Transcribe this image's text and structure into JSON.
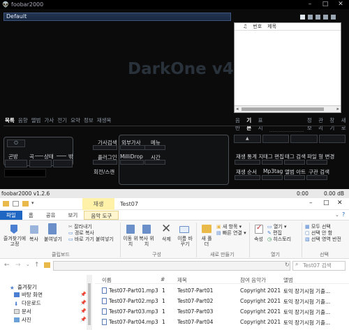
{
  "foobar": {
    "title": "foobar2000",
    "playlist_tab": "Default",
    "logo_text": "DarkOne v4.0",
    "playlist_columns": [
      "♫",
      "번호",
      "제목"
    ],
    "left_tabs": [
      "목록",
      "음향",
      "앨범",
      "가사",
      "전기",
      "요약",
      "정보",
      "재생목"
    ],
    "right_tabs": [
      "음반",
      "기본",
      "표시",
      "가사",
      "",
      "",
      "",
      "",
      "",
      "정보",
      "관리",
      "창기",
      "새로"
    ],
    "right_tab_selected": 1,
    "left_buttons": {
      "power": "⏻",
      "mode": "곤방",
      "track": "곡",
      "state": "상태",
      "num": "밖"
    },
    "center_left_buttons": [
      "가사검색",
      "플러그인",
      "회전/스캔"
    ],
    "center_btns": {
      "lyrics_ext": "외부가사",
      "milli": "MilliDrop",
      "menu": "메뉴",
      "time": "시간"
    },
    "right_buttons": [
      "재생 통계 지",
      "태그 편집",
      "태그 검색",
      "파일 형 변경",
      "재생 순서",
      "Mp3tag",
      "앨범 아트",
      "구관 검색"
    ],
    "status_left": "foobar2000 v1.2.6",
    "status_time_left": "0:00",
    "status_time_right": "0.00 dB"
  },
  "explorer": {
    "context_tab": "재생",
    "folder_name": "Test07",
    "ribbon_tabs": [
      "파일",
      "홈",
      "공유",
      "보기",
      "음악 도구"
    ],
    "ribbon": {
      "pin": "즐겨찾기에 고정",
      "copy": "복사",
      "paste": "붙여넣기",
      "cut": "잘라내기",
      "copy_path": "경로 복사",
      "paste_shortcut": "바로 가기 붙여넣기",
      "move_to": "이동 위치",
      "copy_to": "복사 위치",
      "delete": "삭제",
      "rename": "이름 바꾸기",
      "new_folder": "새 폴더",
      "new_item": "새 항목",
      "easy_access": "빠른 연결",
      "properties": "속성",
      "open": "열기",
      "edit": "편집",
      "history": "히스토리",
      "select_all": "모두 선택",
      "select_none": "선택 안 함",
      "invert": "선택 영역 반전",
      "g_clipboard": "클립보드",
      "g_organize": "구성",
      "g_new": "새로 만들기",
      "g_open": "열기",
      "g_select": "선택"
    },
    "search_placeholder": "Test07 검색",
    "nav": [
      "즐겨찾기",
      "바탕 화면",
      "다운로드",
      "문서",
      "사진"
    ],
    "columns": [
      "이름",
      "#",
      "제목",
      "참여 음악가",
      "앨범"
    ],
    "files": [
      {
        "name": "Test07-Part01.mp3",
        "num": "1",
        "title": "Test07-Part01",
        "artist": "Copyright 2021 Y...",
        "album": "토익 장기시험 기출..."
      },
      {
        "name": "Test07-Part02.mp3",
        "num": "1",
        "title": "Test07-Part02",
        "artist": "Copyright 2021 Y...",
        "album": "토익 장기시험 기출..."
      },
      {
        "name": "Test07-Part03.mp3",
        "num": "1",
        "title": "Test07-Part03",
        "artist": "Copyright 2021 Y...",
        "album": "토익 장기시험 기출..."
      },
      {
        "name": "Test07-Part04.mp3",
        "num": "1",
        "title": "Test07-Part04",
        "artist": "Copyright 2021 Y...",
        "album": "토익 장기시험 기출..."
      }
    ]
  }
}
